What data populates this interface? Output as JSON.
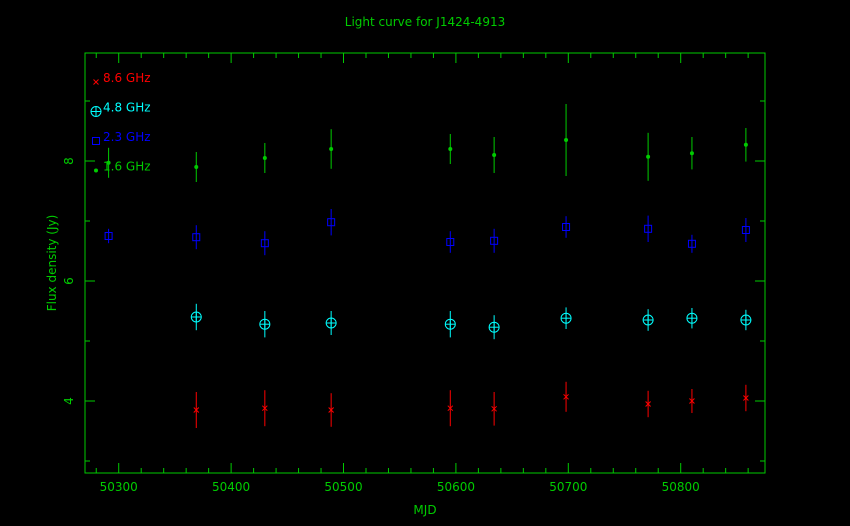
{
  "chart_data": {
    "type": "scatter",
    "title": "Light curve for J1424-4913",
    "xlabel": "MJD",
    "ylabel": "Flux density (Jy)",
    "xlim": [
      50270,
      50875
    ],
    "ylim": [
      2.8,
      9.8
    ],
    "x_ticks": [
      50300,
      50400,
      50500,
      50600,
      50700,
      50800
    ],
    "y_ticks": [
      4,
      6,
      8
    ],
    "legend_position": "top-left",
    "colors": {
      "axes": "#00cc00",
      "background": "#000000"
    },
    "series": [
      {
        "name": "8.6 GHz",
        "color": "#ff0000",
        "marker": "x",
        "points": [
          {
            "x": 50369,
            "y": 3.85,
            "err": 0.3
          },
          {
            "x": 50430,
            "y": 3.88,
            "err": 0.3
          },
          {
            "x": 50489,
            "y": 3.85,
            "err": 0.28
          },
          {
            "x": 50595,
            "y": 3.88,
            "err": 0.3
          },
          {
            "x": 50634,
            "y": 3.87,
            "err": 0.28
          },
          {
            "x": 50698,
            "y": 4.07,
            "err": 0.25
          },
          {
            "x": 50771,
            "y": 3.95,
            "err": 0.22
          },
          {
            "x": 50810,
            "y": 4.0,
            "err": 0.2
          },
          {
            "x": 50858,
            "y": 4.05,
            "err": 0.22
          }
        ]
      },
      {
        "name": "4.8 GHz",
        "color": "#00ffff",
        "marker": "circle-plus",
        "points": [
          {
            "x": 50369,
            "y": 5.4,
            "err": 0.22
          },
          {
            "x": 50430,
            "y": 5.28,
            "err": 0.22
          },
          {
            "x": 50489,
            "y": 5.3,
            "err": 0.2
          },
          {
            "x": 50595,
            "y": 5.28,
            "err": 0.22
          },
          {
            "x": 50634,
            "y": 5.23,
            "err": 0.2
          },
          {
            "x": 50698,
            "y": 5.38,
            "err": 0.18
          },
          {
            "x": 50771,
            "y": 5.35,
            "err": 0.18
          },
          {
            "x": 50810,
            "y": 5.38,
            "err": 0.17
          },
          {
            "x": 50858,
            "y": 5.35,
            "err": 0.17
          }
        ]
      },
      {
        "name": "2.3 GHz",
        "color": "#0000ff",
        "marker": "square",
        "points": [
          {
            "x": 50291,
            "y": 6.75,
            "err": 0.12
          },
          {
            "x": 50369,
            "y": 6.73,
            "err": 0.2
          },
          {
            "x": 50430,
            "y": 6.63,
            "err": 0.2
          },
          {
            "x": 50489,
            "y": 6.98,
            "err": 0.22
          },
          {
            "x": 50595,
            "y": 6.65,
            "err": 0.18
          },
          {
            "x": 50634,
            "y": 6.67,
            "err": 0.2
          },
          {
            "x": 50698,
            "y": 6.9,
            "err": 0.18
          },
          {
            "x": 50771,
            "y": 6.87,
            "err": 0.22
          },
          {
            "x": 50810,
            "y": 6.62,
            "err": 0.15
          },
          {
            "x": 50858,
            "y": 6.85,
            "err": 0.2
          }
        ]
      },
      {
        "name": "1.6 GHz",
        "color": "#00cc00",
        "marker": "dot",
        "points": [
          {
            "x": 50291,
            "y": 7.97,
            "err": 0.25
          },
          {
            "x": 50369,
            "y": 7.9,
            "err": 0.25
          },
          {
            "x": 50430,
            "y": 8.05,
            "err": 0.25
          },
          {
            "x": 50489,
            "y": 8.2,
            "err": 0.33
          },
          {
            "x": 50595,
            "y": 8.2,
            "err": 0.25
          },
          {
            "x": 50634,
            "y": 8.1,
            "err": 0.3
          },
          {
            "x": 50698,
            "y": 8.35,
            "err": 0.6
          },
          {
            "x": 50771,
            "y": 8.07,
            "err": 0.4
          },
          {
            "x": 50810,
            "y": 8.13,
            "err": 0.27
          },
          {
            "x": 50858,
            "y": 8.27,
            "err": 0.28
          }
        ]
      }
    ]
  }
}
